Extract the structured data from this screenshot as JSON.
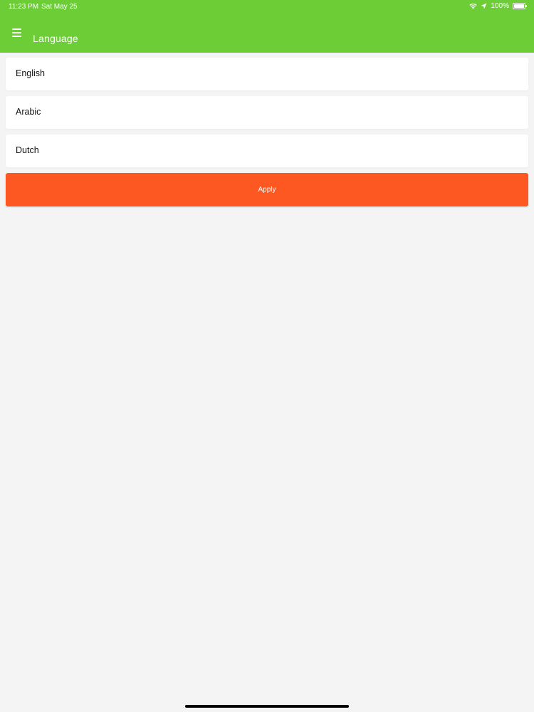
{
  "status_bar": {
    "time": "11:23 PM",
    "date": "Sat May 25",
    "battery": "100%",
    "icons": [
      "wifi-icon",
      "location-arrow-icon",
      "battery-icon"
    ]
  },
  "app_bar": {
    "title": "Language",
    "menu_icon": "hamburger-menu-icon",
    "background_color": "#6ccd37"
  },
  "languages": [
    {
      "label": "English"
    },
    {
      "label": "Arabic"
    },
    {
      "label": "Dutch"
    }
  ],
  "apply_button": {
    "label": "Apply",
    "background_color": "#fd5722"
  },
  "colors": {
    "page_background": "#f5f4f4",
    "item_background": "#ffffff"
  }
}
